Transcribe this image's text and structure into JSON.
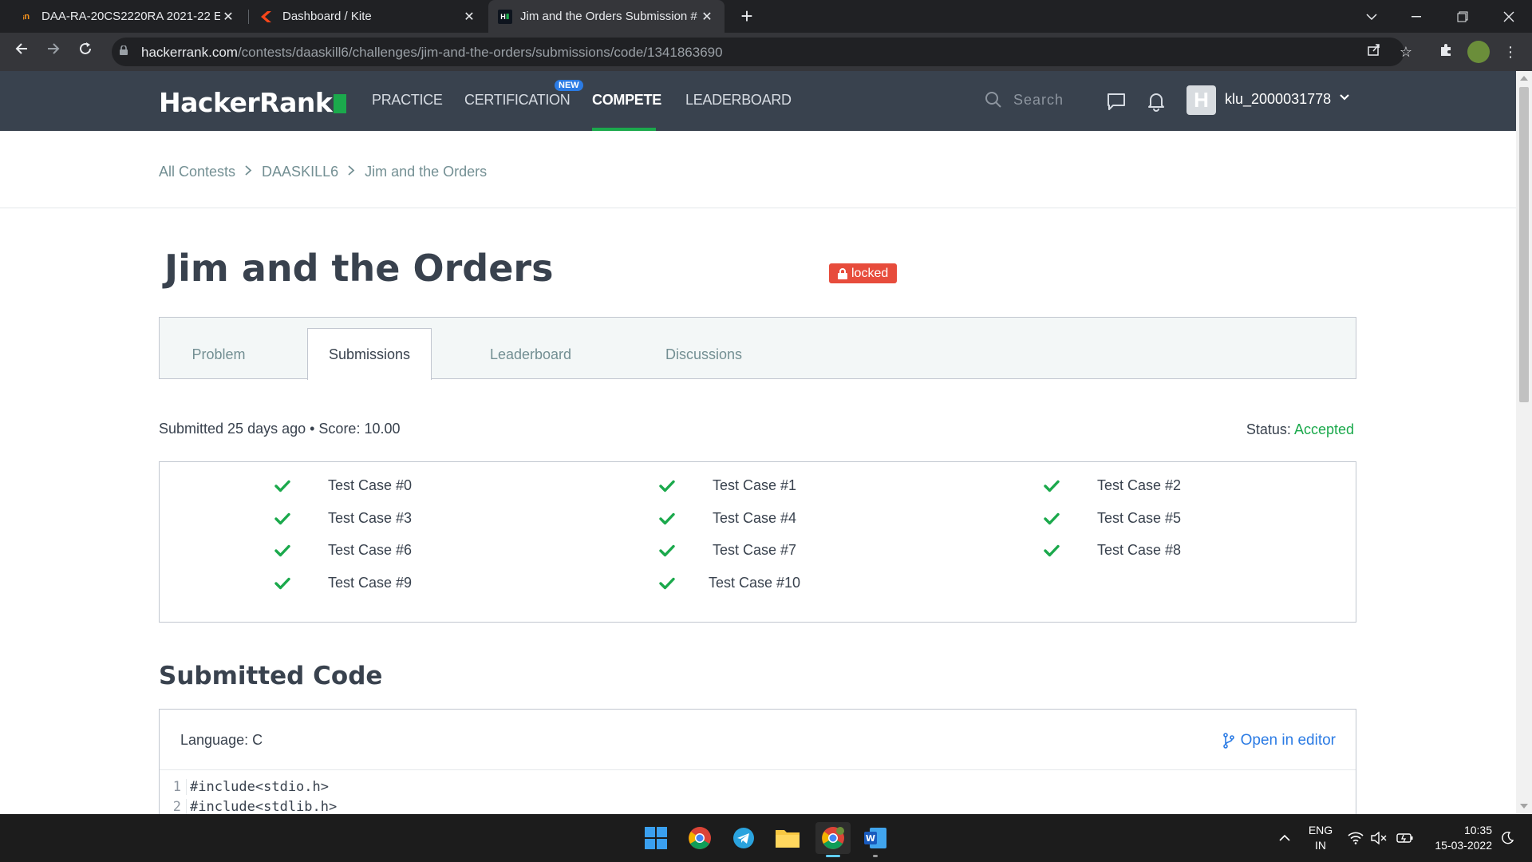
{
  "browser": {
    "tabs": [
      {
        "title": "DAA-RA-20CS2220RA 2021-22 E",
        "close": "✕"
      },
      {
        "title": "Dashboard / Kite",
        "close": "✕"
      },
      {
        "title": "Jim and the Orders Submission #",
        "close": "✕"
      }
    ],
    "new_tab": "+",
    "url_host": "hackerrank.com",
    "url_path": "/contests/daaskill6/challenges/jim-and-the-orders/submissions/code/1341863690"
  },
  "hr_header": {
    "logo": "HackerRank",
    "nav": [
      "PRACTICE",
      "CERTIFICATION",
      "COMPETE",
      "LEADERBOARD"
    ],
    "new_badge": "NEW",
    "search_placeholder": "Search",
    "avatar_letter": "H",
    "username": "klu_2000031778"
  },
  "breadcrumb": [
    "All Contests",
    "DAASKILL6",
    "Jim and the Orders"
  ],
  "challenge": {
    "title": "Jim and the Orders",
    "locked_label": "locked",
    "tabs": [
      "Problem",
      "Submissions",
      "Leaderboard",
      "Discussions"
    ],
    "active_tab": "Submissions"
  },
  "submission": {
    "info": "Submitted 25 days ago • Score: 10.00",
    "status_label": "Status:",
    "status_value": "Accepted",
    "test_cases": [
      "Test Case #0",
      "Test Case #1",
      "Test Case #2",
      "Test Case #3",
      "Test Case #4",
      "Test Case #5",
      "Test Case #6",
      "Test Case #7",
      "Test Case #8",
      "Test Case #9",
      "Test Case #10"
    ],
    "code_heading": "Submitted Code",
    "language": "Language: C",
    "open_editor": "Open in editor",
    "code_lines": [
      {
        "n": "1",
        "text": "#include<stdio.h>"
      },
      {
        "n": "2",
        "text": "#include<stdlib.h>"
      }
    ]
  },
  "taskbar": {
    "lang_top": "ENG",
    "lang_bottom": "IN",
    "time": "10:35",
    "date": "15-03-2022"
  },
  "colors": {
    "hr_header_bg": "#39424e",
    "hr_green": "#1ba94c",
    "locked_red": "#e74c3c",
    "link_blue": "#2b7be4"
  }
}
